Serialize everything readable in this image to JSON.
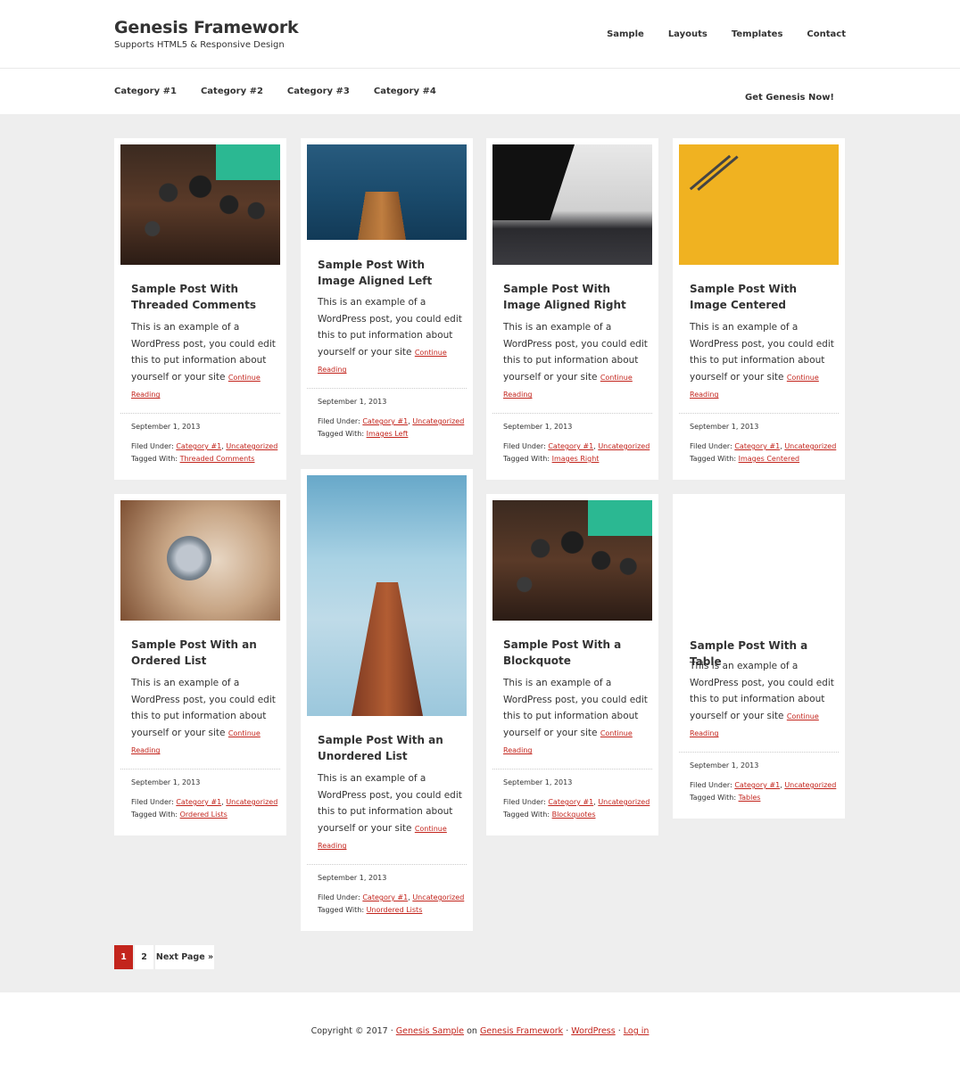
{
  "header": {
    "title": "Genesis Framework",
    "tagline": "Supports HTML5 & Responsive Design",
    "nav": [
      "Sample",
      "Layouts",
      "Templates",
      "Contact"
    ]
  },
  "secondary_nav": {
    "categories": [
      "Category #1",
      "Category #2",
      "Category #3",
      "Category #4"
    ],
    "cta": "Get Genesis Now!"
  },
  "posts": [
    {
      "title": "Sample Post With Threaded Comments",
      "excerpt": "This is an example of a WordPress post, you could edit this to put information about yourself or your site",
      "more": "Continue Reading",
      "date": "September 1, 2013",
      "filed_label": "Filed Under:",
      "cat1": "Category #1",
      "cat2": "Uncategorized",
      "tagged_label": "Tagged With:",
      "tag": "Threaded Comments",
      "image": "circuit-board-image"
    },
    {
      "title": "Sample Post With Image Aligned Left",
      "excerpt": "This is an example of a WordPress post, you could edit this to put information about yourself or your site",
      "more": "Continue Reading",
      "date": "September 1, 2013",
      "filed_label": "Filed Under:",
      "cat1": "Category #1",
      "cat2": "Uncategorized",
      "tagged_label": "Tagged With:",
      "tag": "Images Left",
      "image": "pier-image"
    },
    {
      "title": "Sample Post With Image Aligned Right",
      "excerpt": "This is an example of a WordPress post, you could edit this to put information about yourself or your site",
      "more": "Continue Reading",
      "date": "September 1, 2013",
      "filed_label": "Filed Under:",
      "cat1": "Category #1",
      "cat2": "Uncategorized",
      "tagged_label": "Tagged With:",
      "tag": "Images Right",
      "image": "laptop-image"
    },
    {
      "title": "Sample Post With Image Centered",
      "excerpt": "This is an example of a WordPress post, you could edit this to put information about yourself or your site",
      "more": "Continue Reading",
      "date": "September 1, 2013",
      "filed_label": "Filed Under:",
      "cat1": "Category #1",
      "cat2": "Uncategorized",
      "tagged_label": "Tagged With:",
      "tag": "Images Centered",
      "image": "pencils-image"
    },
    {
      "title": "Sample Post With an Ordered List",
      "excerpt": "This is an example of a WordPress post, you could edit this to put information about yourself or your site",
      "more": "Continue Reading",
      "date": "September 1, 2013",
      "filed_label": "Filed Under:",
      "cat1": "Category #1",
      "cat2": "Uncategorized",
      "tagged_label": "Tagged With:",
      "tag": "Ordered Lists",
      "image": "headphones-image"
    },
    {
      "title": "Sample Post With an Unordered List",
      "excerpt": "This is an example of a WordPress post, you could edit this to put information about yourself or your site",
      "more": "Continue Reading",
      "date": "September 1, 2013",
      "filed_label": "Filed Under:",
      "cat1": "Category #1",
      "cat2": "Uncategorized",
      "tagged_label": "Tagged With:",
      "tag": "Unordered Lists",
      "image": "building-image"
    },
    {
      "title": "Sample Post With a Blockquote",
      "excerpt": "This is an example of a WordPress post, you could edit this to put information about yourself or your site",
      "more": "Continue Reading",
      "date": "September 1, 2013",
      "filed_label": "Filed Under:",
      "cat1": "Category #1",
      "cat2": "Uncategorized",
      "tagged_label": "Tagged With:",
      "tag": "Blockquotes",
      "image": "circuit-board-image"
    },
    {
      "title": "Sample Post With a Table",
      "excerpt": "This is an example of a WordPress post, you could edit this to put information about yourself or your site",
      "more": "Continue Reading",
      "date": "September 1, 2013",
      "filed_label": "Filed Under:",
      "cat1": "Category #1",
      "cat2": "Uncategorized",
      "tagged_label": "Tagged With:",
      "tag": "Tables",
      "image": "none"
    }
  ],
  "pagination": {
    "current": "1",
    "page2": "2",
    "next": "Next Page »"
  },
  "footer": {
    "copyright": "Copyright © 2017 ·",
    "sample": "Genesis Sample",
    "on": "on",
    "framework": "Genesis Framework",
    "dot1": "·",
    "wordpress": "WordPress",
    "dot2": "·",
    "login": "Log in"
  },
  "colors": {
    "accent": "#c3251d",
    "background": "#eeeeee"
  }
}
